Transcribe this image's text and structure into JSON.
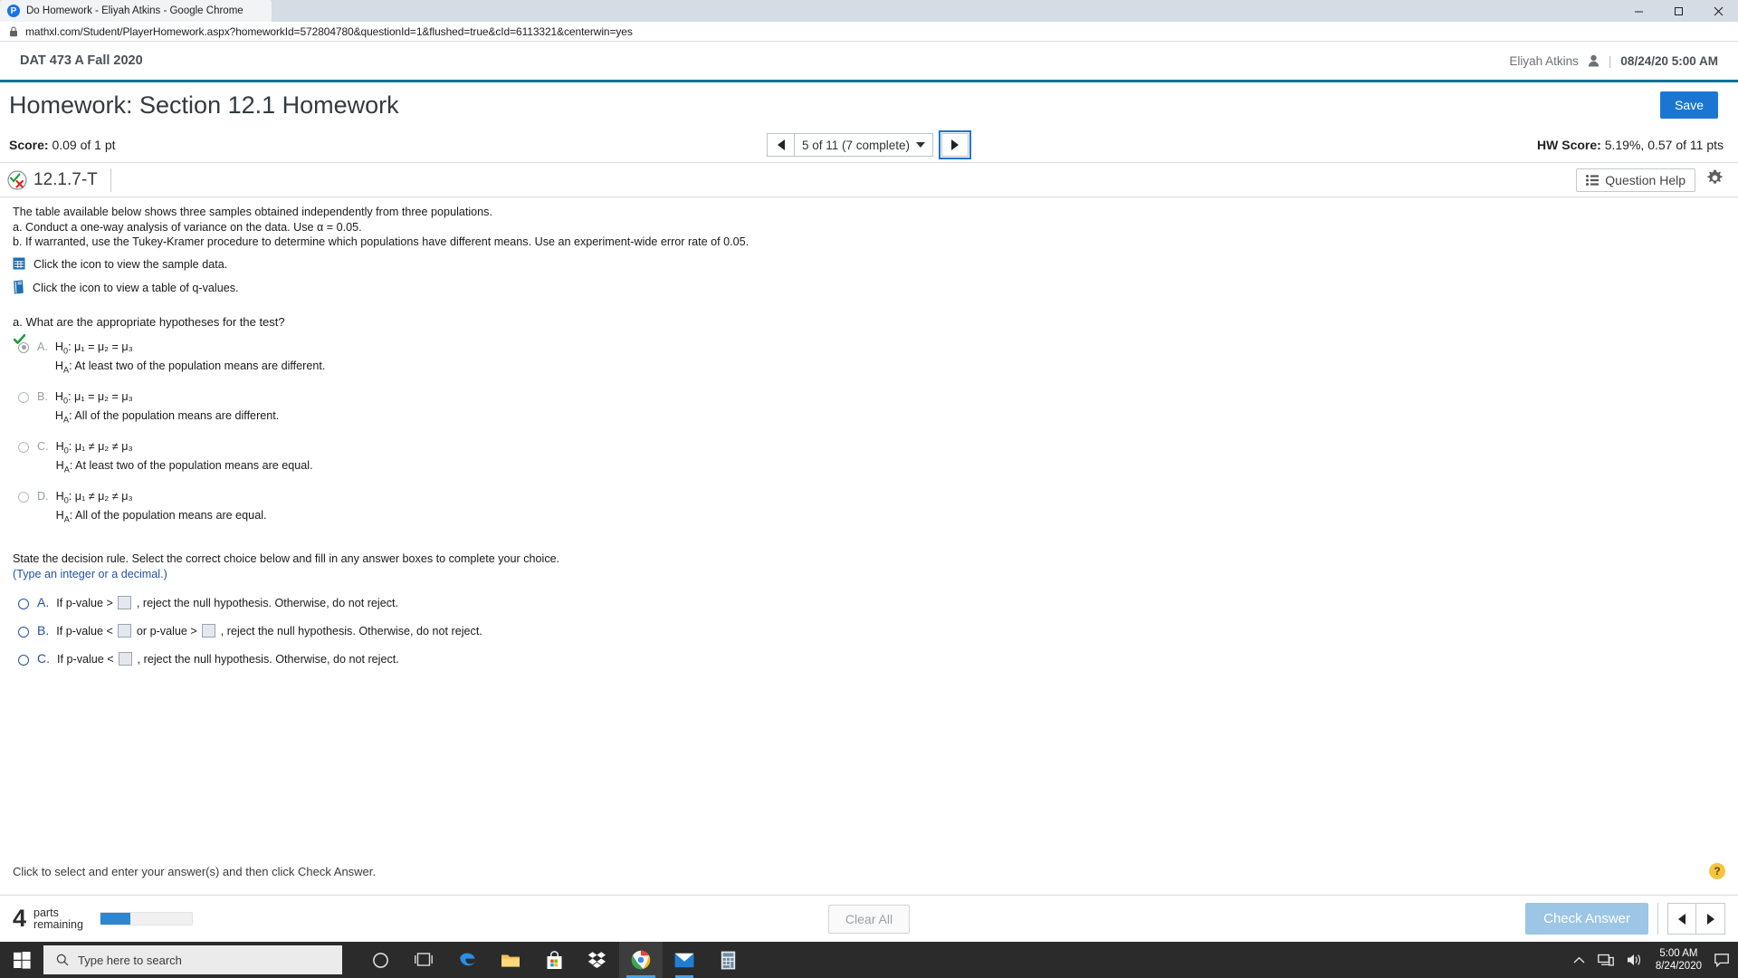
{
  "browser": {
    "tab_title": "Do Homework - Eliyah Atkins - Google Chrome",
    "favicon_letter": "P",
    "url": "mathxl.com/Student/PlayerHomework.aspx?homeworkId=572804780&questionId=1&flushed=true&cId=6113321&centerwin=yes",
    "minimize_label": "—",
    "maximize_label": "❐",
    "close_label": "✕"
  },
  "header": {
    "course": "DAT 473 A Fall 2020",
    "user_name": "Eliyah Atkins",
    "divider": "|",
    "timestamp": "08/24/20 5:00 AM"
  },
  "title_row": {
    "title": "Homework: Section 12.1 Homework",
    "save_label": "Save"
  },
  "score_bar": {
    "score_label": "Score:",
    "score_value": "0.09 of 1 pt",
    "question_selector": "5 of 11 (7 complete)",
    "hw_score_label": "HW Score:",
    "hw_score_value": "5.19%, 0.57 of 11 pts"
  },
  "question_header": {
    "question_id": "12.1.7-T",
    "question_help_label": "Question Help",
    "gear_tooltip": "Settings"
  },
  "stem": {
    "line1": "The table available below shows three samples obtained independently from three populations.",
    "line2": "a. Conduct a one-way analysis of variance on the data. Use α = 0.05.",
    "line3": "b. If warranted, use the Tukey-Kramer procedure to determine which populations have different means. Use an experiment-wide error rate of 0.05.",
    "link_sample_data": "Click the icon to view the sample data.",
    "link_q_values": "Click the icon to view a table of q-values."
  },
  "part_a": {
    "prompt": "a. What are the appropriate hypotheses for the test?",
    "choices": [
      {
        "letter": "A.",
        "null_prefix": "H",
        "null_sub": "0",
        "null_body": ": μ₁ = μ₂ = μ₃",
        "alt_prefix": "H",
        "alt_sub": "A",
        "alt_body": ": At least two of the population means are different.",
        "state": "selected-correct"
      },
      {
        "letter": "B.",
        "null_prefix": "H",
        "null_sub": "0",
        "null_body": ": μ₁ = μ₂ = μ₃",
        "alt_prefix": "H",
        "alt_sub": "A",
        "alt_body": ": All of the population means are different.",
        "state": "unselected"
      },
      {
        "letter": "C.",
        "null_prefix": "H",
        "null_sub": "0",
        "null_body": ": μ₁ ≠ μ₂ ≠ μ₃",
        "alt_prefix": "H",
        "alt_sub": "A",
        "alt_body": ": At least two of the population means are equal.",
        "state": "unselected"
      },
      {
        "letter": "D.",
        "null_prefix": "H",
        "null_sub": "0",
        "null_body": ": μ₁ ≠ μ₂ ≠ μ₃",
        "alt_prefix": "H",
        "alt_sub": "A",
        "alt_body": ": All of the population means are equal.",
        "state": "unselected"
      }
    ]
  },
  "decision_rule": {
    "prompt": "State the decision rule. Select the correct choice below and fill in any answer boxes to complete your choice.",
    "note": "(Type an integer or a decimal.)",
    "choices": [
      {
        "letter": "A.",
        "seg1": "If p-value >",
        "seg2": ", reject the null hypothesis. Otherwise, do not reject.",
        "seg3": "",
        "boxes": 1,
        "box1_value": "",
        "box2_value": ""
      },
      {
        "letter": "B.",
        "seg1": "If p-value <",
        "seg2": "or p-value >",
        "seg3": ", reject the null hypothesis. Otherwise, do not reject.",
        "boxes": 2,
        "box1_value": "",
        "box2_value": ""
      },
      {
        "letter": "C.",
        "seg1": "If p-value <",
        "seg2": ", reject the null hypothesis. Otherwise, do not reject.",
        "seg3": "",
        "boxes": 1,
        "box1_value": "",
        "box2_value": ""
      }
    ]
  },
  "footer": {
    "hint": "Click to select and enter your answer(s) and then click Check Answer.",
    "help_glyph": "?",
    "parts_number": "4",
    "parts_word1": "parts",
    "parts_word2": "remaining",
    "progress_percent": 33,
    "clear_all_label": "Clear All",
    "check_answer_label": "Check Answer"
  },
  "taskbar": {
    "search_placeholder": "Type here to search",
    "clock_time": "5:00 AM",
    "clock_date": "8/24/2020"
  },
  "colors": {
    "accent_teal": "#00748f",
    "save_blue": "#1b76d2",
    "link_blue": "#2352a0",
    "progress_blue": "#2f86d0",
    "check_disabled": "#9dc5e4",
    "correct_green": "#1f9d3a"
  }
}
